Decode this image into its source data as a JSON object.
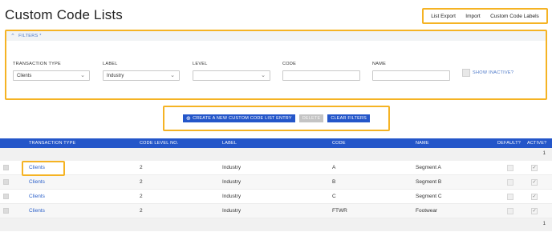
{
  "page": {
    "title": "Custom Code Lists"
  },
  "top_links": [
    "List Export",
    "Import",
    "Custom Code Labels"
  ],
  "filters": {
    "header": "FILTERS *",
    "transaction_type": {
      "label": "TRANSACTION TYPE",
      "value": "Clients"
    },
    "label": {
      "label": "LABEL",
      "value": "Industry"
    },
    "level": {
      "label": "LEVEL",
      "value": ""
    },
    "code": {
      "label": "CODE",
      "value": ""
    },
    "name": {
      "label": "NAME",
      "value": ""
    },
    "show_inactive": {
      "label": "SHOW INACTIVE?",
      "checked": false
    }
  },
  "actions": {
    "create_label": "CREATE A NEW CUSTOM CODE LIST ENTRY",
    "delete_label": "DELETE",
    "clear_label": "CLEAR FILTERS"
  },
  "grid": {
    "columns": [
      "TRANSACTION TYPE",
      "CODE LEVEL NO.",
      "LABEL",
      "CODE",
      "NAME",
      "DEFAULT?",
      "ACTIVE?"
    ],
    "top_page": "1",
    "bottom_page": "1",
    "rows": [
      {
        "transaction_type": "Clients",
        "level": "2",
        "label": "Industry",
        "code": "A",
        "name": "Segment A",
        "default": false,
        "active": true
      },
      {
        "transaction_type": "Clients",
        "level": "2",
        "label": "Industry",
        "code": "B",
        "name": "Segment B",
        "default": false,
        "active": true
      },
      {
        "transaction_type": "Clients",
        "level": "2",
        "label": "Industry",
        "code": "C",
        "name": "Segment C",
        "default": false,
        "active": true
      },
      {
        "transaction_type": "Clients",
        "level": "2",
        "label": "Industry",
        "code": "FTWR",
        "name": "Footwear",
        "default": false,
        "active": true
      }
    ]
  },
  "colors": {
    "accent": "#2456c9",
    "highlight": "#f5b324",
    "link": "#2a5fc9"
  },
  "icons": {
    "filter_toggle": "chevron-up-icon",
    "dropdown": "chevron-down-icon",
    "create": "plus-circle-icon",
    "check": "check-icon"
  }
}
